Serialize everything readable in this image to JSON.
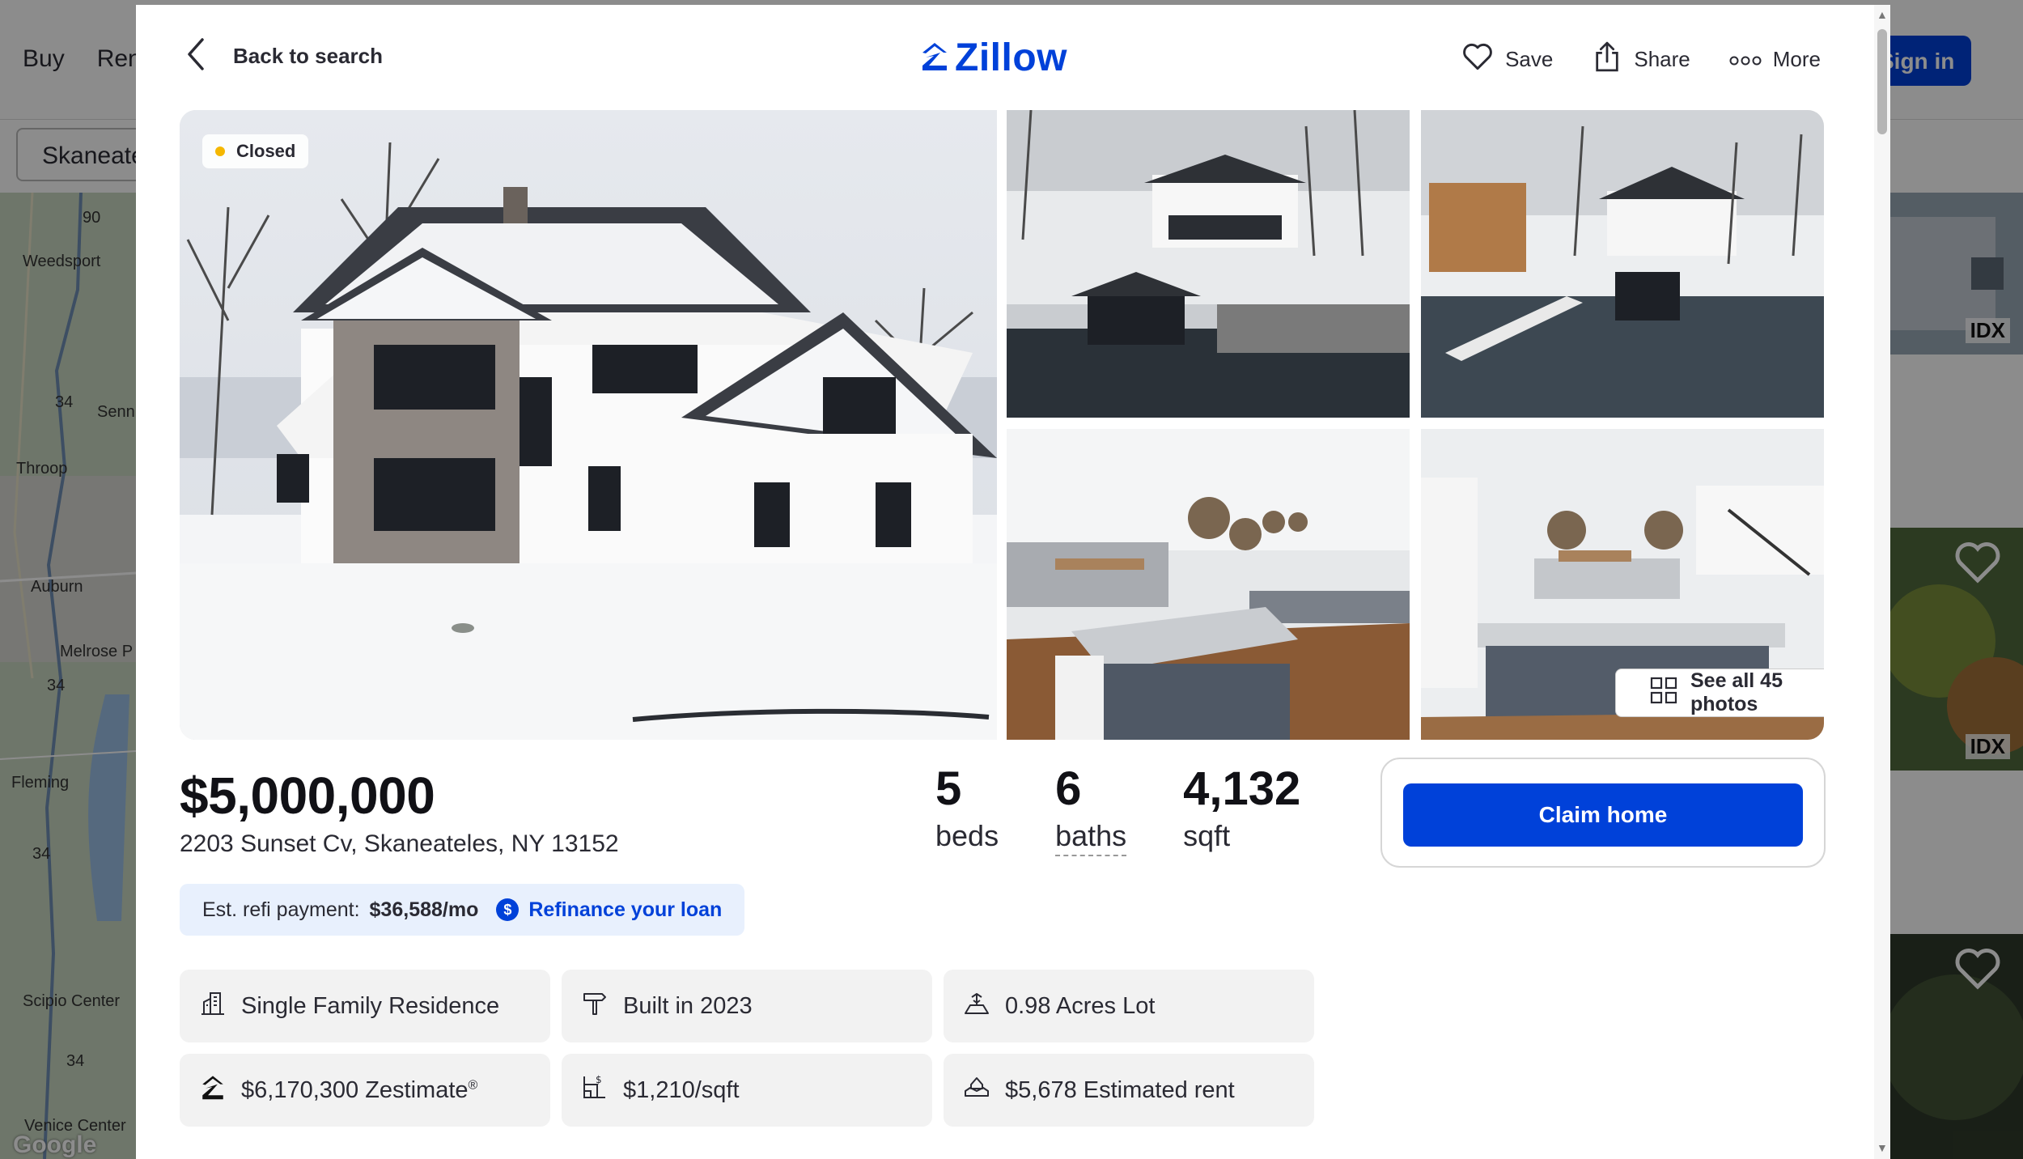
{
  "background": {
    "nav": [
      "Buy",
      "Ren"
    ],
    "search_value": "Skaneate",
    "sign_in": "Sign in",
    "map_labels": [
      "Weedsport",
      "Senn",
      "Throop",
      "Auburn",
      "Melrose P",
      "Fleming",
      "Scipio Center",
      "Venice Center"
    ],
    "map_routes": [
      "90",
      "34",
      "34",
      "34",
      "34"
    ],
    "map_attribution": "Google",
    "listing_badge": "IDX"
  },
  "header": {
    "back_label": "Back to search",
    "logo_text": "Zillow",
    "actions": {
      "save": "Save",
      "share": "Share",
      "more": "More"
    }
  },
  "gallery": {
    "status": "Closed",
    "see_all": "See all 45 photos"
  },
  "summary": {
    "price": "$5,000,000",
    "address": "2203 Sunset Cv, Skaneateles, NY 13152",
    "beds_value": "5",
    "beds_label": "beds",
    "baths_value": "6",
    "baths_label": "baths",
    "sqft_value": "4,132",
    "sqft_label": "sqft"
  },
  "claim": {
    "button": "Claim home"
  },
  "refi": {
    "label": "Est. refi payment:",
    "amount": "$36,588/mo",
    "icon_text": "$",
    "link": "Refinance your loan"
  },
  "facts": {
    "type": "Single Family Residence",
    "built": "Built in 2023",
    "lot": "0.98 Acres Lot",
    "zestimate": "$6,170,300 Zestimate",
    "zestimate_mark": "®",
    "price_per_sqft": "$1,210/sqft",
    "rent": "$5,678 Estimated rent"
  },
  "colors": {
    "brand_blue": "#0041d9",
    "status_closed": "#f5b700"
  }
}
